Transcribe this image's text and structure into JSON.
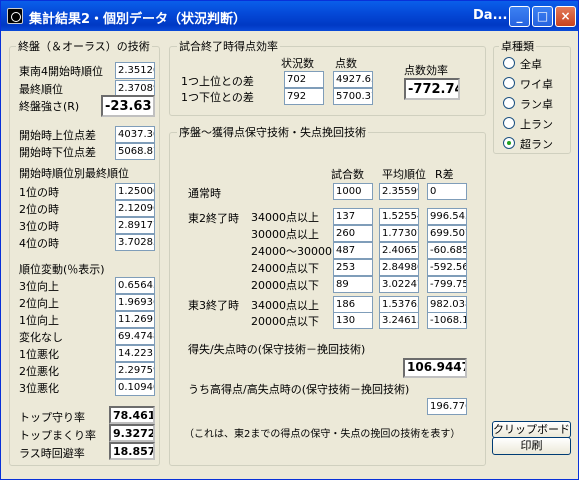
{
  "window": {
    "title": "集計結果2・個別データ（状況判断）",
    "title_suffix": "Da...",
    "buttons": {
      "minimize": "_",
      "maximize": "□",
      "close": "×"
    }
  },
  "endgame": {
    "title": "終盤（＆オーラス）の技術",
    "east4_avg_rank_label": "東南4開始時順位",
    "east4_avg_rank": "2.35120",
    "final_rank_label": "最終順位",
    "final_rank": "2.37089",
    "strength_label": "終盤強さ(R)",
    "strength": "-23.63",
    "start_upper_diff_label": "開始時上位点差",
    "start_upper_diff": "4037.30",
    "start_lower_diff_label": "開始時下位点差",
    "start_lower_diff": "5068.87",
    "by_rank_title": "開始時順位別最終順位",
    "by_rank": [
      {
        "label": "1位の時",
        "value": "1.25000"
      },
      {
        "label": "2位の時",
        "value": "2.12096"
      },
      {
        "label": "3位の時",
        "value": "2.89177"
      },
      {
        "label": "4位の時",
        "value": "3.70285"
      }
    ],
    "change_title": "順位変動(％表示)",
    "changes": [
      {
        "label": "3位向上",
        "value": "0.65645"
      },
      {
        "label": "2位向上",
        "value": "1.96936"
      },
      {
        "label": "1位向上",
        "value": "11.2691"
      },
      {
        "label": "変化なし",
        "value": "69.4748"
      },
      {
        "label": "1位悪化",
        "value": "14.2231"
      },
      {
        "label": "2位悪化",
        "value": "2.29759"
      },
      {
        "label": "3位悪化",
        "value": "0.10940"
      }
    ],
    "top_keep_label": "トップ守り率",
    "top_keep": "78.4615",
    "top_overtake_label": "トップまくり率",
    "top_overtake": "9.32721",
    "last_avoid_label": "ラス時回避率",
    "last_avoid": "18.8571"
  },
  "efficiency": {
    "title": "試合終了時得点効率",
    "col_status": "状況数",
    "col_points": "点数",
    "col_eff": "点数効率",
    "row1_label": "1つ上位との差",
    "row1_status": "702",
    "row1_points": "4927.63",
    "row2_label": "1つ下位との差",
    "row2_status": "792",
    "row2_points": "5700.37",
    "efficiency_value": "-772.74"
  },
  "tech": {
    "title": "序盤～獲得点保守技術・失点挽回技術",
    "col_games": "試合数",
    "col_avg_rank": "平均順位",
    "col_r": "R差",
    "normal_label": "通常時",
    "normal": {
      "games": "1000",
      "avg": "2.35599",
      "r": "0"
    },
    "east2_label": "東2終了時",
    "east2": [
      {
        "label": "34000点以上",
        "games": "137",
        "avg": "1.52554",
        "r": "996.543"
      },
      {
        "label": "30000点以上",
        "games": "260",
        "avg": "1.77307",
        "r": "699.507"
      },
      {
        "label": "24000～30000",
        "games": "487",
        "avg": "2.40657",
        "r": "-60.685"
      },
      {
        "label": "24000点以下",
        "games": "253",
        "avg": "2.84980",
        "r": "-592.56"
      },
      {
        "label": "20000点以下",
        "games": "89",
        "avg": "3.02247",
        "r": "-799.75"
      }
    ],
    "east3_label": "東3終了時",
    "east3": [
      {
        "label": "34000点以上",
        "games": "186",
        "avg": "1.53763",
        "r": "982.038"
      },
      {
        "label": "20000点以下",
        "games": "130",
        "avg": "3.24615",
        "r": "-1068.1"
      }
    ],
    "gain_loss_label": "得失/失点時の(保守技術－挽回技術)",
    "gain_loss_value": "106.9447",
    "high_low_label": "うち高得点/高失点時の(保守技術－挽回技術)",
    "high_low_value": "196.776",
    "note": "（これは、東2までの得点の保守・失点の挽回の技術を表す）"
  },
  "table_type": {
    "title": "卓種類",
    "options": [
      "全卓",
      "ワイ卓",
      "ラン卓",
      "上ラン",
      "超ラン"
    ],
    "selected": 4
  },
  "clipboard_button": "クリップボード",
  "print_button": "印刷"
}
